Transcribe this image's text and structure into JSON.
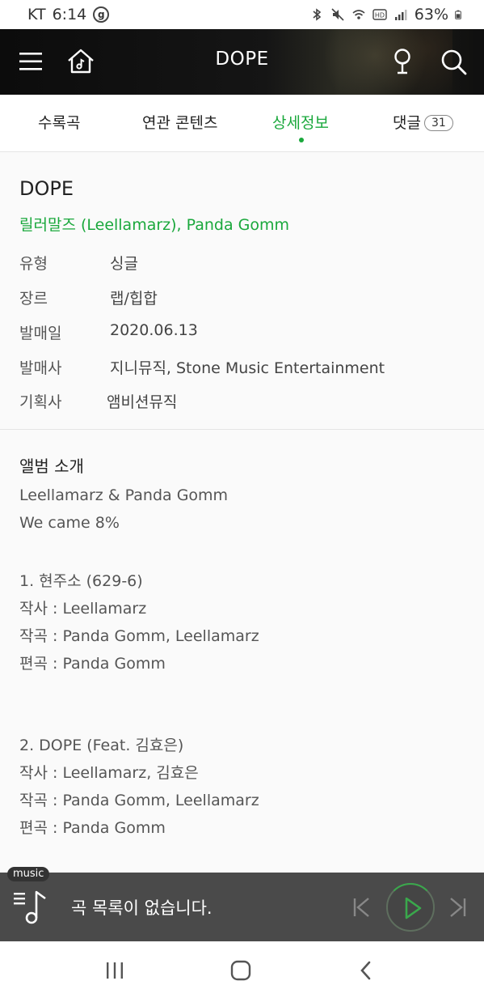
{
  "status_bar": {
    "carrier": "KT",
    "time": "6:14",
    "g_badge": "g",
    "battery": "63%",
    "icons": [
      "bluetooth-icon",
      "mute-icon",
      "wifi-icon",
      "hd-icon",
      "signal-icon",
      "battery-icon"
    ]
  },
  "header": {
    "title": "DOPE",
    "icons": [
      "menu-icon",
      "home-music-icon",
      "microphone-icon",
      "search-icon"
    ]
  },
  "tabs": [
    {
      "label": "수록곡",
      "active": false
    },
    {
      "label": "연관 콘텐츠",
      "active": false
    },
    {
      "label": "상세정보",
      "active": true
    },
    {
      "label": "댓글",
      "active": false,
      "count": "31"
    }
  ],
  "detail": {
    "album_title": "DOPE",
    "artists": "릴러말즈 (Leellamarz), Panda Gomm",
    "rows": [
      {
        "label": "유형",
        "value": "싱글"
      },
      {
        "label": "장르",
        "value": "랩/힙합"
      },
      {
        "label": "발매일",
        "value": "2020.06.13"
      },
      {
        "label": "발매사",
        "value": "지니뮤직, Stone Music Entertainment"
      },
      {
        "label": "기획사",
        "value": "앰비션뮤직"
      }
    ]
  },
  "intro": {
    "title": "앨범 소개",
    "lines": [
      "Leellamarz & Panda Gomm",
      "We came 8%",
      "1. 현주소 (629-6)",
      "작사 : Leellamarz",
      "작곡 : Panda Gomm, Leellamarz",
      "편곡 : Panda Gomm",
      "2. DOPE (Feat. 김효은)",
      "작사 : Leellamarz, 김효은",
      "작곡 : Panda Gomm, Leellamarz",
      "편곡 : Panda Gomm"
    ]
  },
  "player": {
    "pill": "music",
    "text": "곡 목록이 없습니다.",
    "colors": {
      "accent": "#1aa83c",
      "bar": "#4a4a4a"
    }
  },
  "colors": {
    "accent": "#1aa83c"
  }
}
